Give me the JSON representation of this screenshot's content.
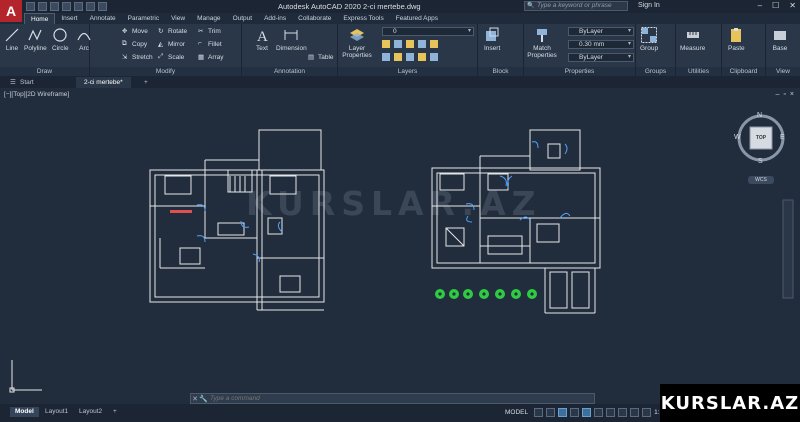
{
  "app": {
    "logo_letter": "A",
    "window_title": "Autodesk AutoCAD 2020   2-ci mertebe.dwg",
    "search_placeholder": "Type a keyword or phrase",
    "sign_in": "Sign In"
  },
  "ribbon_tabs": [
    "Home",
    "Insert",
    "Annotate",
    "Parametric",
    "View",
    "Manage",
    "Output",
    "Add-ins",
    "Collaborate",
    "Express Tools",
    "Featured Apps"
  ],
  "active_ribbon_tab": "Home",
  "panels": {
    "draw": {
      "title": "Draw",
      "buttons": [
        "Line",
        "Polyline",
        "Circle",
        "Arc"
      ]
    },
    "modify": {
      "title": "Modify",
      "buttons": [
        "Move",
        "Rotate",
        "Trim",
        "Copy",
        "Mirror",
        "Fillet",
        "Stretch",
        "Scale",
        "Array"
      ]
    },
    "annotation": {
      "title": "Annotation",
      "buttons": [
        "Text",
        "Dimension",
        "Table"
      ]
    },
    "layers": {
      "title": "Layers",
      "buttons": [
        "Layer Properties"
      ],
      "current_layer": "0"
    },
    "block": {
      "title": "Block",
      "buttons": [
        "Insert"
      ]
    },
    "properties": {
      "title": "Properties",
      "buttons": [
        "Match Properties"
      ],
      "color": "ByLayer",
      "lineweight": "0.30 mm",
      "linetype": "ByLayer"
    },
    "groups": {
      "title": "Groups",
      "buttons": [
        "Group"
      ]
    },
    "utilities": {
      "title": "Utilities",
      "buttons": [
        "Measure"
      ]
    },
    "clipboard": {
      "title": "Clipboard",
      "buttons": [
        "Paste"
      ]
    },
    "view": {
      "title": "View",
      "buttons": [
        "Base"
      ]
    }
  },
  "doc_tabs": [
    "Start",
    "2-ci mertebe*"
  ],
  "active_doc_tab": "2-ci mertebe*",
  "viewport": {
    "label": "[−][Top][2D Wireframe]",
    "viewcube": {
      "top": "TOP",
      "n": "N",
      "s": "S",
      "e": "E",
      "w": "W",
      "wcs": "WCS"
    },
    "watermark": "KURSLAR.AZ"
  },
  "command_line": {
    "placeholder": "Type a command"
  },
  "layout_tabs": [
    "Model",
    "Layout1",
    "Layout2"
  ],
  "active_layout_tab": "Model",
  "status": {
    "model_label": "MODEL",
    "scale": "1:1"
  },
  "badge": "KURSLAR.AZ",
  "colors": {
    "accent": "#b3252b",
    "background": "#212d3d",
    "linework": "#e6e6e6",
    "blue_doors": "#4fa3ff",
    "trees": "#2ecc40"
  }
}
